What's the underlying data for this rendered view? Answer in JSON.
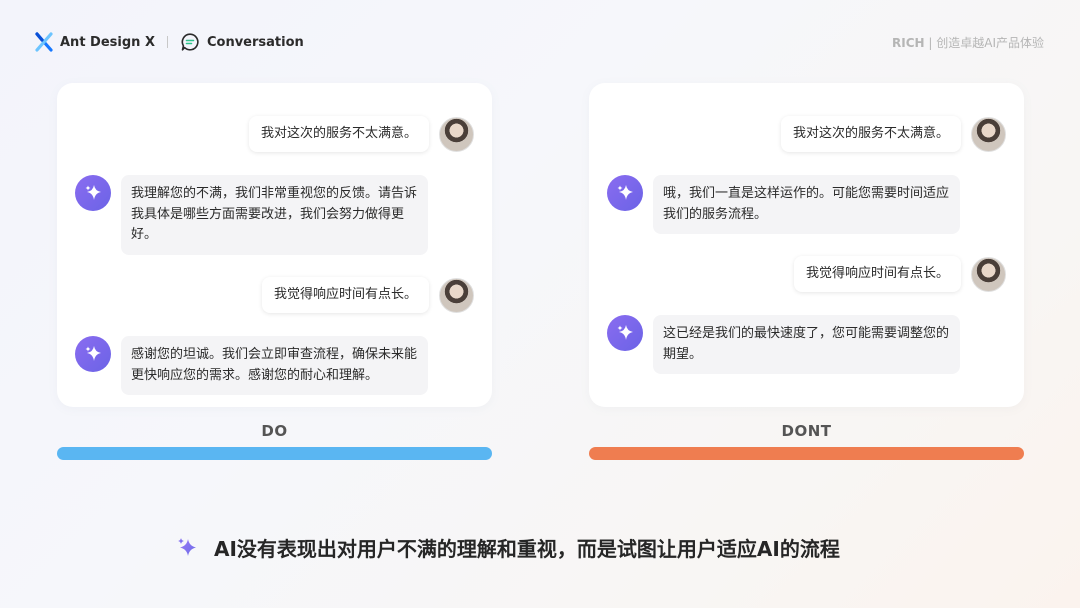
{
  "header": {
    "brand_name": "Ant Design X",
    "product_name": "Conversation",
    "tagline_strong": "RICH",
    "tagline_sep": " | ",
    "tagline_text": "创造卓越AI产品体验"
  },
  "do_panel": {
    "label": "DO",
    "bar_color": "#5ab6f2",
    "messages": [
      {
        "role": "user",
        "text": "我对这次的服务不太满意。"
      },
      {
        "role": "ai",
        "text": "我理解您的不满，我们非常重视您的反馈。请告诉我具体是哪些方面需要改进，我们会努力做得更好。"
      },
      {
        "role": "user",
        "text": "我觉得响应时间有点长。"
      },
      {
        "role": "ai",
        "text": "感谢您的坦诚。我们会立即审查流程，确保未来能更快响应您的需求。感谢您的耐心和理解。"
      }
    ]
  },
  "dont_panel": {
    "label": "DONT",
    "bar_color": "#ef7d50",
    "messages": [
      {
        "role": "user",
        "text": "我对这次的服务不太满意。"
      },
      {
        "role": "ai",
        "text": "哦，我们一直是这样运作的。可能您需要时间适应我们的服务流程。"
      },
      {
        "role": "user",
        "text": "我觉得响应时间有点长。"
      },
      {
        "role": "ai",
        "text": "这已经是我们的最快速度了，您可能需要调整您的期望。"
      }
    ]
  },
  "conclusion": {
    "icon": "sparkle-icon",
    "text": "AI没有表现出对用户不满的理解和重视，而是试图让用户适应AI的流程"
  },
  "colors": {
    "ai_avatar": "#7a66ec",
    "do_accent": "#5ab6f2",
    "dont_accent": "#ef7d50"
  }
}
